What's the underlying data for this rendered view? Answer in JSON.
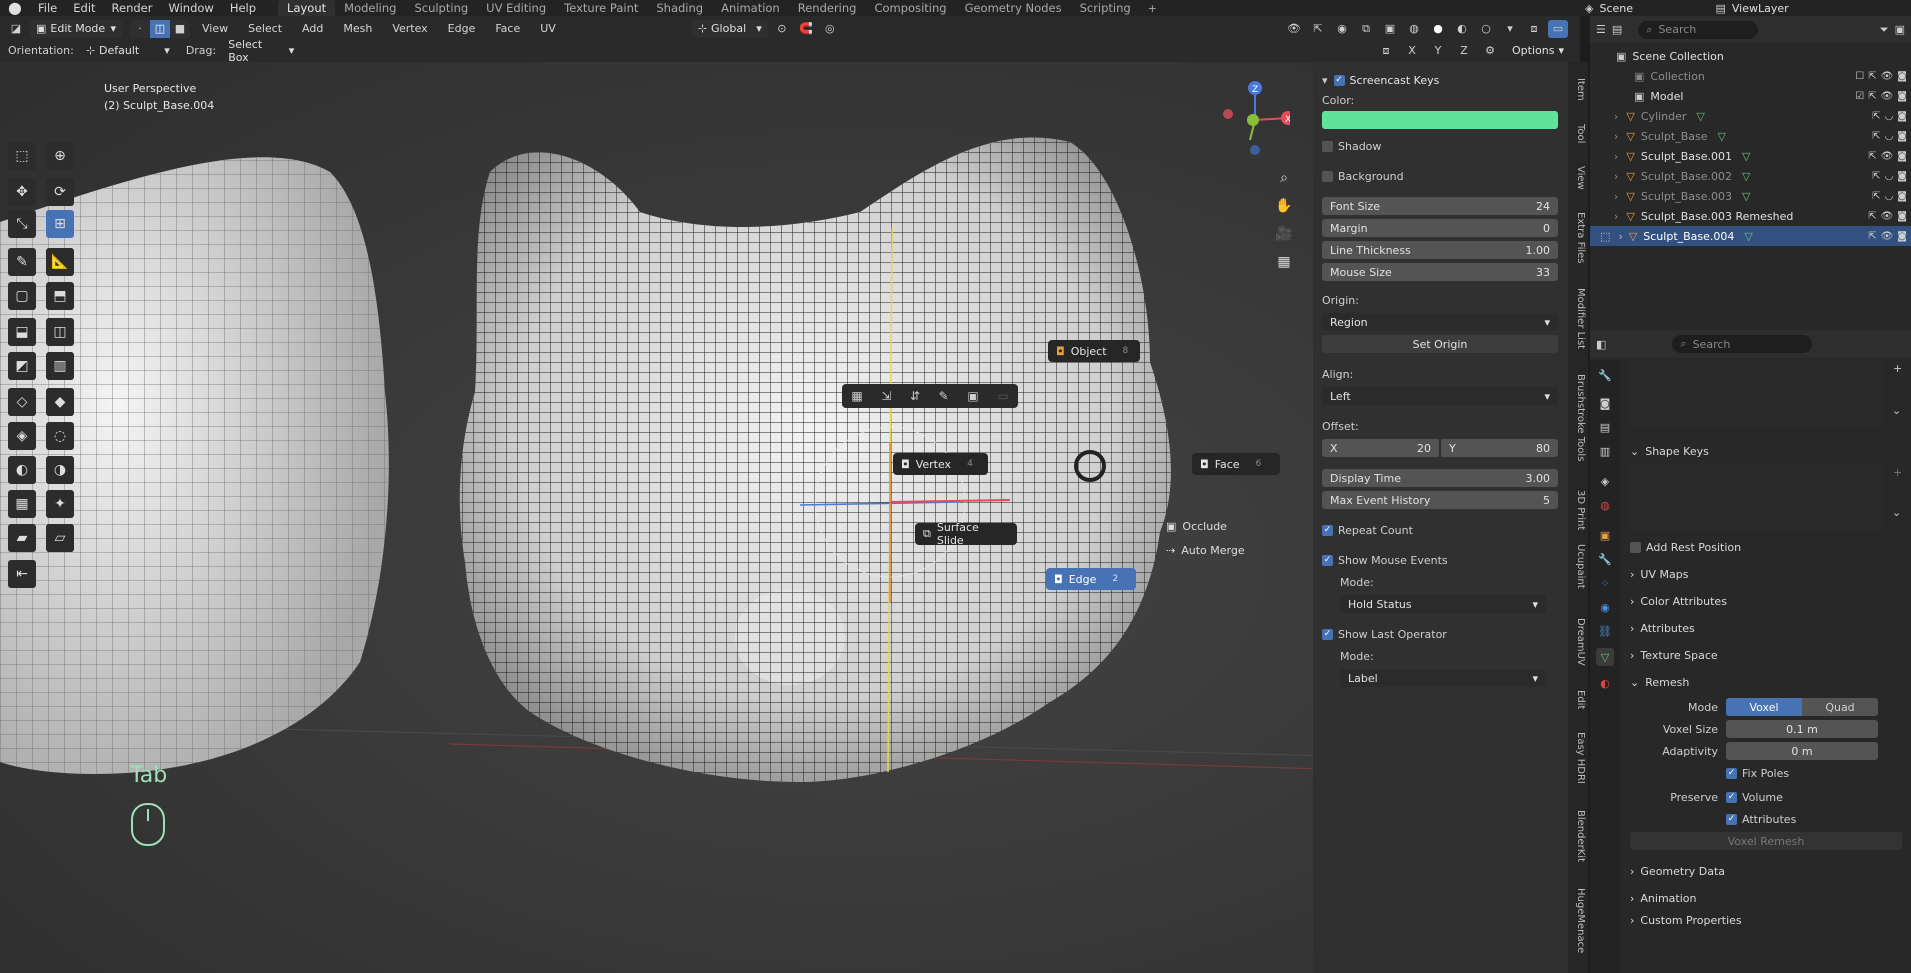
{
  "topbar": {
    "menus": [
      "File",
      "Edit",
      "Render",
      "Window",
      "Help"
    ],
    "workspaces": [
      "Layout",
      "Modeling",
      "Sculpting",
      "UV Editing",
      "Texture Paint",
      "Shading",
      "Animation",
      "Rendering",
      "Compositing",
      "Geometry Nodes",
      "Scripting"
    ],
    "active_workspace": "Layout",
    "scene": "Scene",
    "view_layer": "ViewLayer"
  },
  "header": {
    "mode": "Edit Mode",
    "menus": [
      "View",
      "Select",
      "Add",
      "Mesh",
      "Vertex",
      "Edge",
      "Face",
      "UV"
    ],
    "transform_orientation": "Global",
    "orientation_label": "Orientation:",
    "orientation_value": "Default",
    "drag_label": "Drag:",
    "drag_value": "Select Box",
    "axes": [
      "X",
      "Y",
      "Z"
    ],
    "options": "Options"
  },
  "viewport": {
    "perspective": "User Perspective",
    "object": "(2) Sculpt_Base.004",
    "key_display": "Tab"
  },
  "pie_menu": {
    "object": {
      "label": "Object",
      "key": "8"
    },
    "vertex": {
      "label": "Vertex",
      "key": "4"
    },
    "face": {
      "label": "Face",
      "key": "6"
    },
    "surface_slide": "Surface Slide",
    "occlude": "Occlude",
    "auto_merge": "Auto Merge",
    "edge": {
      "label": "Edge",
      "key": "2"
    }
  },
  "screencast": {
    "title": "Screencast Keys",
    "color_label": "Color:",
    "color": "#5fe39a",
    "shadow": "Shadow",
    "background": "Background",
    "font_size": {
      "label": "Font Size",
      "value": "24"
    },
    "margin": {
      "label": "Margin",
      "value": "0"
    },
    "line_thickness": {
      "label": "Line Thickness",
      "value": "1.00"
    },
    "mouse_size": {
      "label": "Mouse Size",
      "value": "33"
    },
    "origin_label": "Origin:",
    "origin_value": "Region",
    "set_origin": "Set Origin",
    "align_label": "Align:",
    "align_value": "Left",
    "offset_label": "Offset:",
    "offset_x": {
      "label": "X",
      "value": "20"
    },
    "offset_y": {
      "label": "Y",
      "value": "80"
    },
    "display_time": {
      "label": "Display Time",
      "value": "3.00"
    },
    "max_event_history": {
      "label": "Max Event History",
      "value": "5"
    },
    "repeat_count": "Repeat Count",
    "show_mouse_events": "Show Mouse Events",
    "mode_label": "Mode:",
    "mouse_mode": "Hold Status",
    "show_last_operator": "Show Last Operator",
    "mode_label2": "Mode:",
    "last_op_mode": "Label"
  },
  "sidebar_tabs": [
    "Item",
    "Tool",
    "View",
    "Extra Files",
    "Modifier List",
    "Brushstroke Tools",
    "3D Print",
    "Ucupaint",
    "DreamUV",
    "Edit",
    "Easy HDRI",
    "BlenderKit",
    "HugeMenace"
  ],
  "outliner": {
    "search": "Search",
    "root": "Scene Collection",
    "items": [
      "Collection",
      "Model",
      "Cylinder",
      "Sculpt_Base",
      "Sculpt_Base.001",
      "Sculpt_Base.002",
      "Sculpt_Base.003",
      "Sculpt_Base.003 Remeshed",
      "Sculpt_Base.004"
    ]
  },
  "properties": {
    "search": "Search",
    "shape_keys": "Shape Keys",
    "add_rest_position": "Add Rest Position",
    "uv_maps": "UV Maps",
    "color_attributes": "Color Attributes",
    "attributes": "Attributes",
    "texture_space": "Texture Space",
    "remesh": "Remesh",
    "mode_label": "Mode",
    "mode_voxel": "Voxel",
    "mode_quad": "Quad",
    "voxel_size": {
      "label": "Voxel Size",
      "value": "0.1 m"
    },
    "adaptivity": {
      "label": "Adaptivity",
      "value": "0 m"
    },
    "fix_poles": "Fix Poles",
    "preserve_label": "Preserve",
    "volume": "Volume",
    "attributes_chk": "Attributes",
    "voxel_remesh": "Voxel Remesh",
    "geometry_data": "Geometry Data",
    "animation": "Animation",
    "custom_properties": "Custom Properties"
  }
}
